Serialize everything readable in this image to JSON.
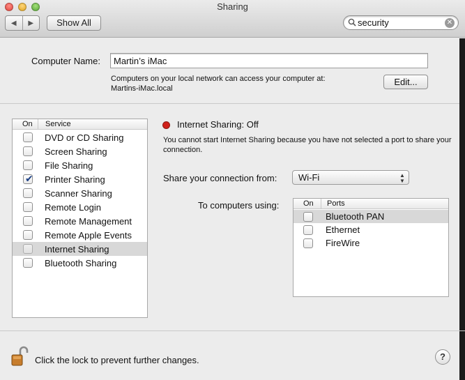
{
  "window": {
    "title": "Sharing"
  },
  "toolbar": {
    "back_glyph": "◀",
    "forward_glyph": "▶",
    "show_all_label": "Show All",
    "search_value": "security",
    "search_clear_glyph": "✕"
  },
  "computer_name": {
    "label": "Computer Name:",
    "value": "Martin’s iMac",
    "note_line1": "Computers on your local network can access your computer at:",
    "note_line2": "Martins-iMac.local",
    "edit_label": "Edit..."
  },
  "services": {
    "header_on": "On",
    "header_service": "Service",
    "items": [
      {
        "name": "DVD or CD Sharing",
        "checked": false,
        "selected": false
      },
      {
        "name": "Screen Sharing",
        "checked": false,
        "selected": false
      },
      {
        "name": "File Sharing",
        "checked": false,
        "selected": false
      },
      {
        "name": "Printer Sharing",
        "checked": true,
        "selected": false
      },
      {
        "name": "Scanner Sharing",
        "checked": false,
        "selected": false
      },
      {
        "name": "Remote Login",
        "checked": false,
        "selected": false
      },
      {
        "name": "Remote Management",
        "checked": false,
        "selected": false
      },
      {
        "name": "Remote Apple Events",
        "checked": false,
        "selected": false
      },
      {
        "name": "Internet Sharing",
        "checked": false,
        "selected": true
      },
      {
        "name": "Bluetooth Sharing",
        "checked": false,
        "selected": false
      }
    ]
  },
  "detail": {
    "status_text": "Internet Sharing: Off",
    "status_color": "#d0201a",
    "description": "You cannot start Internet Sharing because you have not selected a port to share your connection.",
    "share_from_label": "Share your connection from:",
    "share_from_value": "Wi-Fi",
    "to_computers_label": "To computers using:",
    "ports_header_on": "On",
    "ports_header_ports": "Ports",
    "ports": [
      {
        "name": "Bluetooth PAN",
        "checked": false,
        "selected": true
      },
      {
        "name": "Ethernet",
        "checked": false,
        "selected": false
      },
      {
        "name": "FireWire",
        "checked": false,
        "selected": false
      }
    ]
  },
  "bottom": {
    "lock_text": "Click the lock to prevent further changes.",
    "help_glyph": "?"
  }
}
